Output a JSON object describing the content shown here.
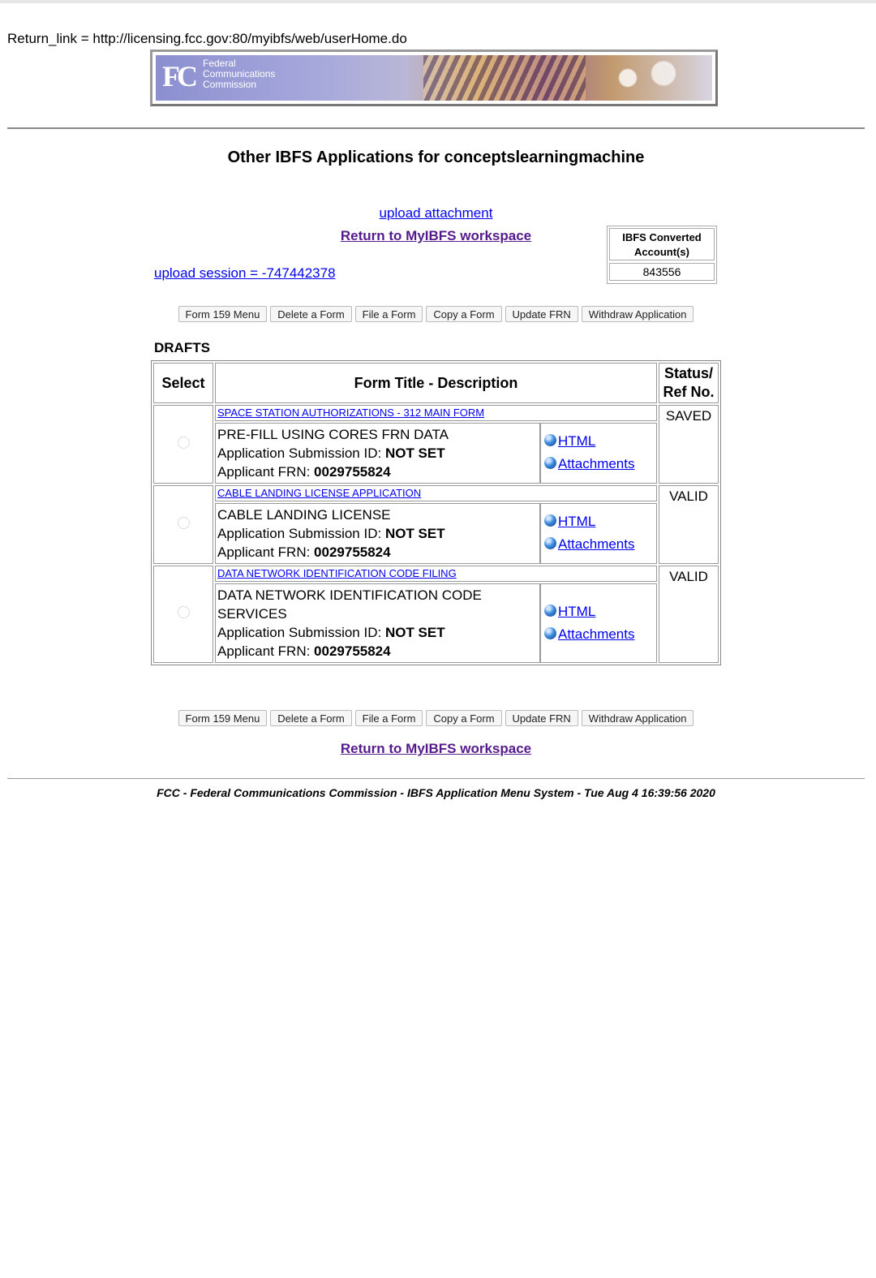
{
  "return_link_text": "Return_link = http://licensing.fcc.gov:80/myibfs/web/userHome.do",
  "banner": {
    "logo_letters": "FC",
    "line1": "Federal",
    "line2": "Communications",
    "line3": "Commission"
  },
  "page_title": "Other IBFS Applications for conceptslearningmachine",
  "links": {
    "upload_attachment": "upload attachment",
    "return_workspace": "Return to MyIBFS workspace",
    "upload_session": "upload session = -747442378"
  },
  "account_box": {
    "header": "IBFS Converted Account(s)",
    "value": "843556"
  },
  "buttons": [
    "Form 159 Menu",
    "Delete a Form",
    "File a Form",
    "Copy a Form",
    "Update FRN",
    "Withdraw Application"
  ],
  "drafts": {
    "label": "DRAFTS",
    "columns": {
      "select": "Select",
      "title": "Form Title - Description",
      "status_line1": "Status/",
      "status_line2": "Ref No."
    },
    "rows": [
      {
        "title_link": "SPACE STATION AUTHORIZATIONS - 312 MAIN FORM",
        "description": "PRE-FILL USING CORES FRN DATA",
        "submission_label": "Application Submission ID: ",
        "submission_value": "NOT SET",
        "frn_label": "Applicant FRN: ",
        "frn_value": "0029755824",
        "html_link": "HTML",
        "attachments_link": "Attachments",
        "status": "SAVED"
      },
      {
        "title_link": "CABLE LANDING LICENSE APPLICATION",
        "description": "CABLE LANDING LICENSE",
        "submission_label": "Application Submission ID: ",
        "submission_value": "NOT SET",
        "frn_label": "Applicant FRN: ",
        "frn_value": "0029755824",
        "html_link": "HTML",
        "attachments_link": "Attachments",
        "status": "VALID"
      },
      {
        "title_link": "DATA NETWORK IDENTIFICATION CODE FILING",
        "description": "DATA NETWORK IDENTIFICATION CODE SERVICES",
        "submission_label": "Application Submission ID: ",
        "submission_value": "NOT SET",
        "frn_label": "Applicant FRN: ",
        "frn_value": "0029755824",
        "html_link": "HTML",
        "attachments_link": "Attachments",
        "status": "VALID"
      }
    ]
  },
  "footer": "FCC - Federal Communications Commission - IBFS Application Menu System - Tue Aug 4 16:39:56 2020"
}
